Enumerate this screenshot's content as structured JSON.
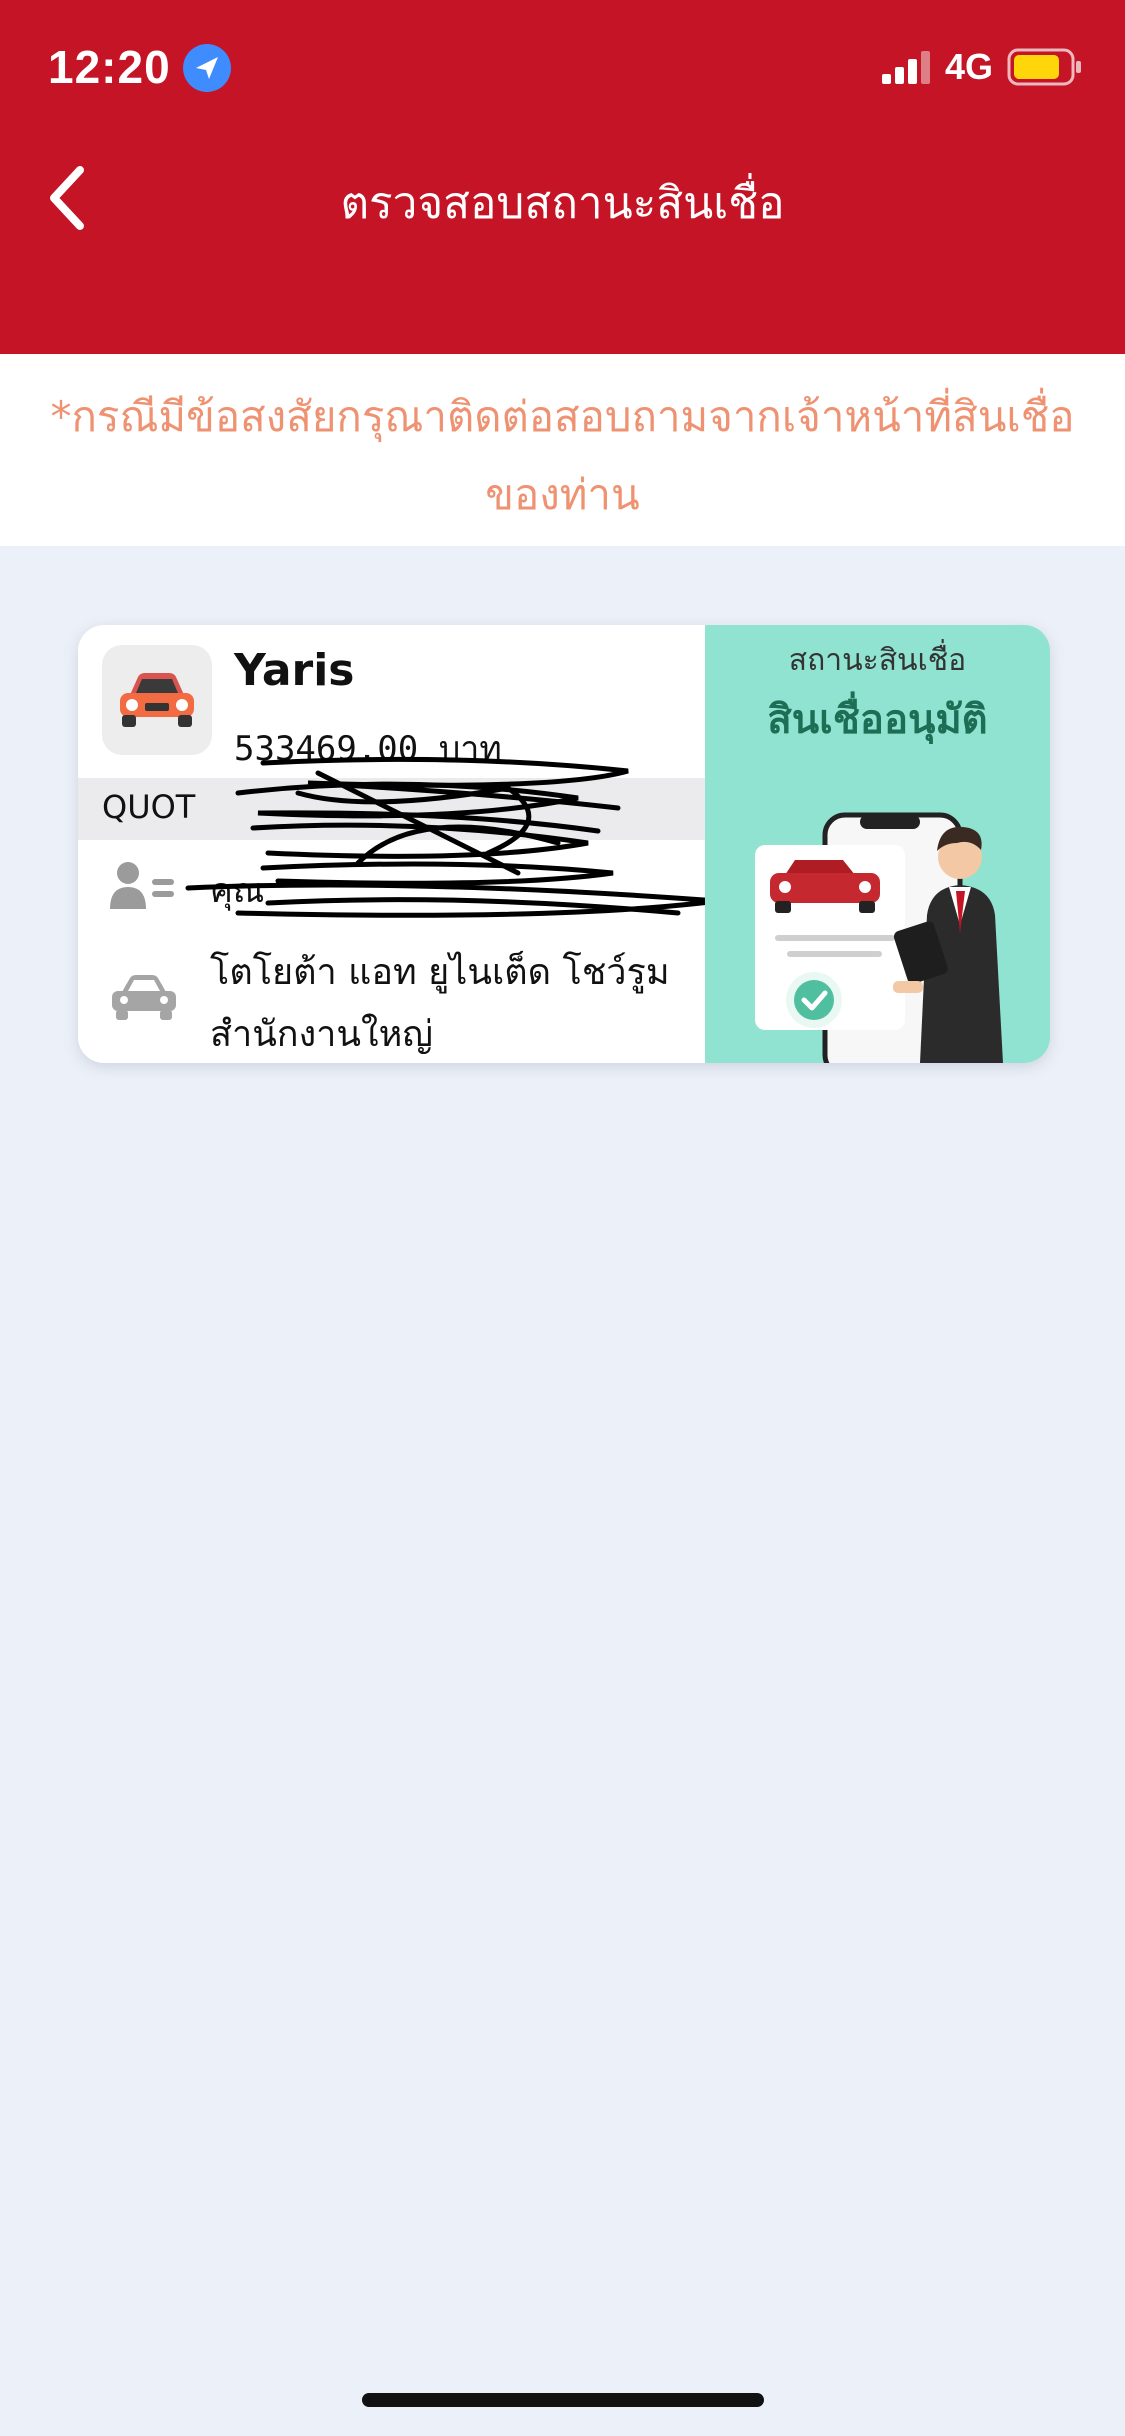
{
  "status_bar": {
    "time": "12:20",
    "network": "4G",
    "icons": [
      "location-arrow-icon",
      "signal-bars-icon",
      "battery-icon"
    ],
    "battery_color": "#ffd60a"
  },
  "header": {
    "title": "ตรวจสอบสถานะสินเชื่อ",
    "back_icon": "chevron-left-icon",
    "background": "#c41426"
  },
  "notice": {
    "text": "*กรณีมีข้อสงสัยกรุณาติดต่อสอบถามจากเจ้าหน้าที่สินเชื่อของท่าน",
    "color": "#ef9272"
  },
  "loan_card": {
    "model": "Yaris",
    "price": "533469.00 บาท",
    "band_text": "QUOT",
    "customer_text": "คุณ",
    "dealer_name": "โตโยต้า แอท ยูไนเต็ด โชว์รูม",
    "dealer_branch": "สำนักงานใหญ่",
    "status_label": "สถานะสินเชื่อ",
    "status_value": "สินเชื่ออนุมัติ",
    "status_panel_color": "#8fe3d0",
    "icons": [
      "car-front-icon",
      "person-id-icon",
      "car-side-icon",
      "approval-illustration"
    ]
  }
}
